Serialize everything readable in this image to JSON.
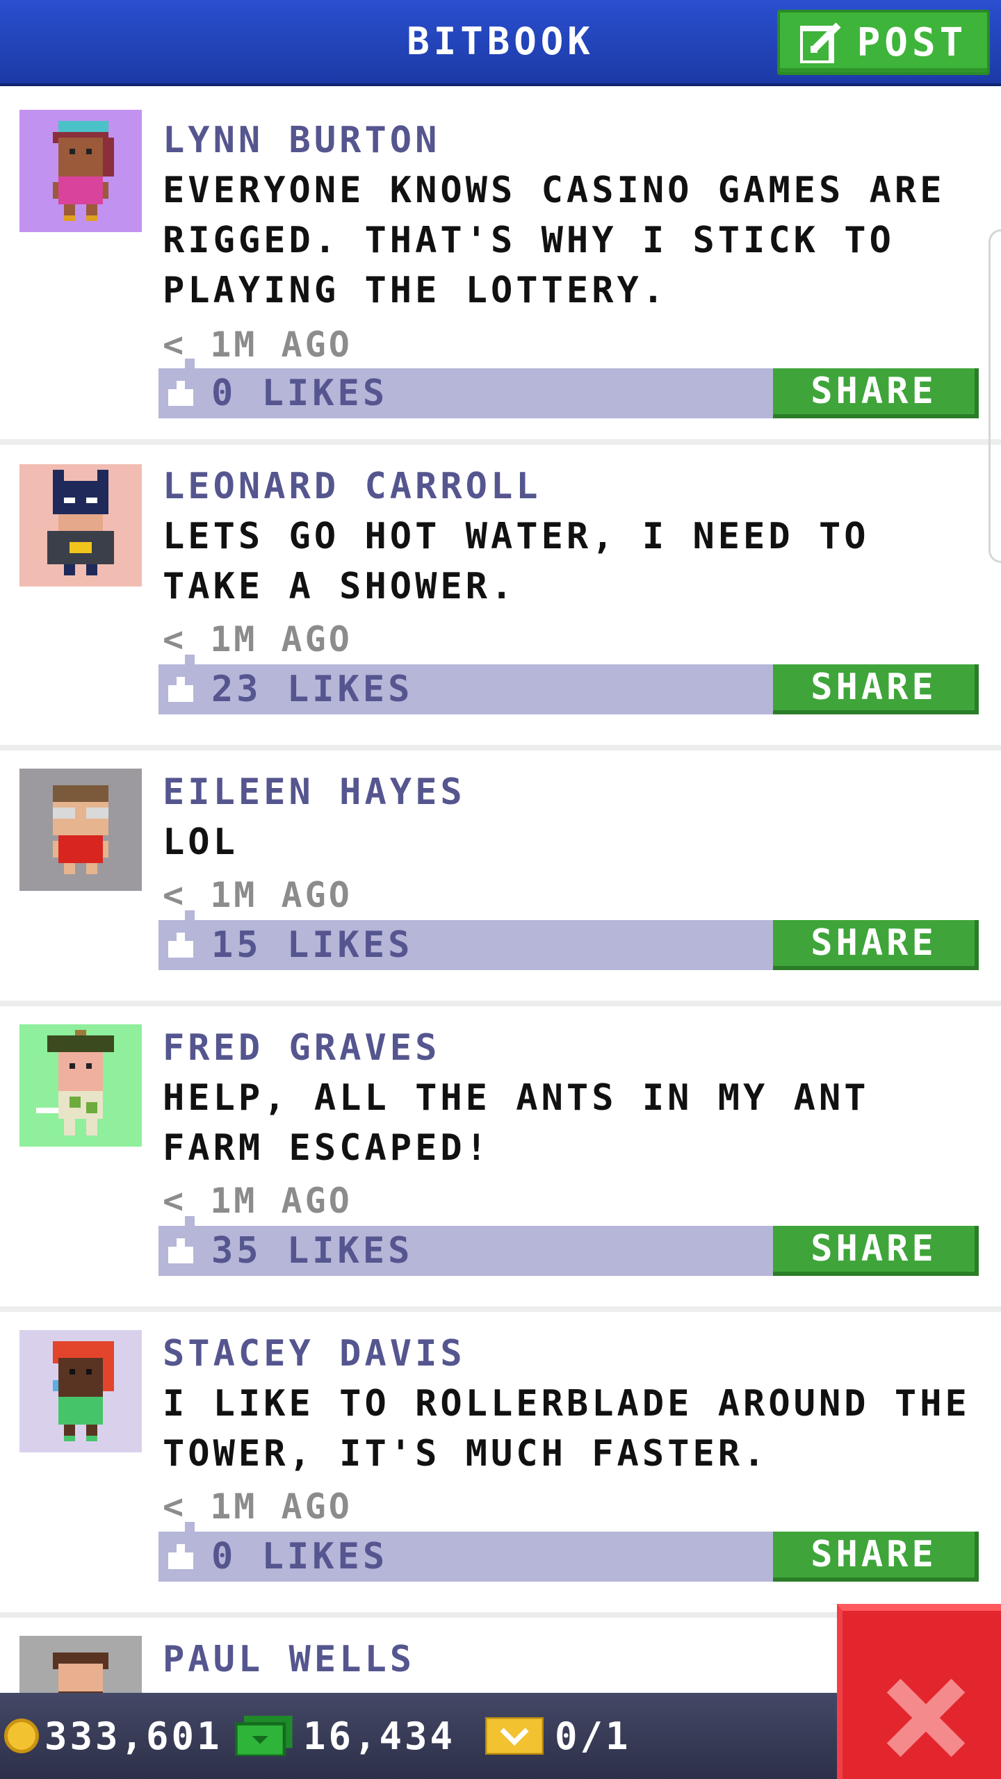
{
  "header": {
    "title": "BITBOOK",
    "post_button": "POST"
  },
  "posts": [
    {
      "author": "LYNN BURTON",
      "message": "EVERYONE KNOWS CASINO GAMES ARE RIGGED. THAT'S WHY I STICK TO PLAYING THE LOTTERY.",
      "time": "< 1M AGO",
      "likes": "0 LIKES",
      "share": "SHARE",
      "avatar_bg": "#c292f0"
    },
    {
      "author": "LEONARD CARROLL",
      "message": "LETS GO HOT WATER, I NEED TO TAKE A SHOWER.",
      "time": "< 1M AGO",
      "likes": "23 LIKES",
      "share": "SHARE",
      "avatar_bg": "#f1bdb3"
    },
    {
      "author": "EILEEN HAYES",
      "message": "LOL",
      "time": "< 1M AGO",
      "likes": "15 LIKES",
      "share": "SHARE",
      "avatar_bg": "#9c9a9e"
    },
    {
      "author": "FRED GRAVES",
      "message": "HELP, ALL THE ANTS IN MY ANT FARM ESCAPED!",
      "time": "< 1M AGO",
      "likes": "35 LIKES",
      "share": "SHARE",
      "avatar_bg": "#8fef9c"
    },
    {
      "author": "STACEY DAVIS",
      "message": "I LIKE TO ROLLERBLADE AROUND THE TOWER, IT'S MUCH FASTER.",
      "time": "< 1M AGO",
      "likes": "0 LIKES",
      "share": "SHARE",
      "avatar_bg": "#d9d1ec"
    },
    {
      "author": "PAUL WELLS",
      "avatar_bg": "#a9a9a9"
    }
  ],
  "status": {
    "coins": "333,601",
    "bux": "16,434",
    "tickets": "0/1"
  },
  "colors": {
    "header_blue": "#2a4fcf",
    "share_green": "#3fa53a",
    "likes_bar": "#b5b6d8",
    "author_purple": "#55558f",
    "close_red": "#e3262d"
  }
}
